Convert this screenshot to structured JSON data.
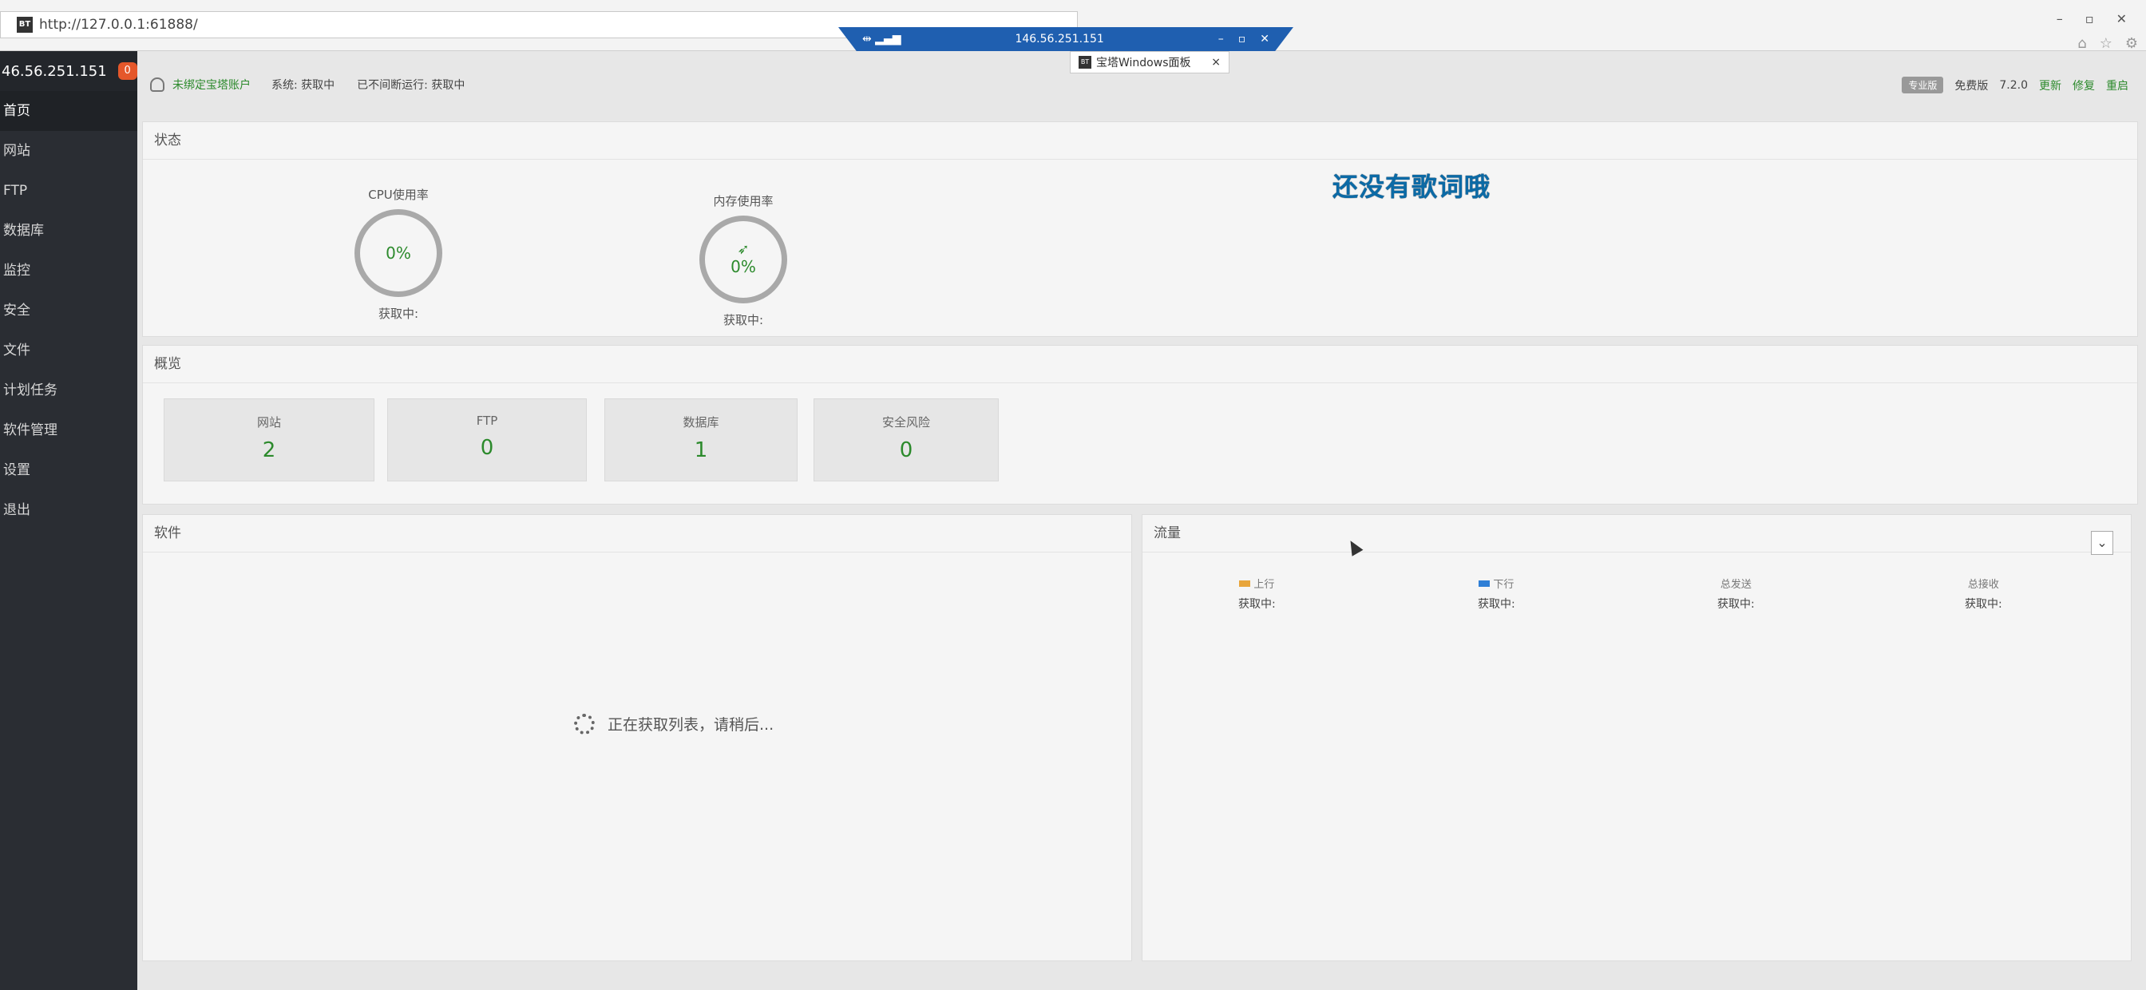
{
  "browser": {
    "url": "http://127.0.0.1:61888/",
    "favicon_text": "BT",
    "tab_title": "宝塔Windows面板",
    "tab_close": "×",
    "addr_search": "⌕",
    "addr_refresh": "⟳",
    "window_controls": [
      "–",
      "▫",
      "✕"
    ]
  },
  "remote_bar": {
    "title": "146.56.251.151",
    "controls": [
      "–",
      "▫",
      "✕"
    ]
  },
  "sidebar": {
    "host": "46.56.251.151",
    "badge": "0",
    "items": [
      "首页",
      "网站",
      "FTP",
      "数据库",
      "监控",
      "安全",
      "文件",
      "计划任务",
      "软件管理",
      "设置",
      "退出"
    ],
    "active_index": 0
  },
  "topbar": {
    "bind_account": "未绑定宝塔账户",
    "system": "系统:",
    "system_value": "获取中",
    "uptime": "已不间断运行: 获取中",
    "pro_label": "专业版",
    "edition": "免费版",
    "version": "7.2.0",
    "update": "更新",
    "repair": "修复",
    "restart": "重启"
  },
  "status": {
    "title": "状态",
    "cpu_label": "CPU使用率",
    "cpu_value": "0%",
    "cpu_sub": "获取中:",
    "mem_label": "内存使用率",
    "mem_value": "0%",
    "mem_sub": "获取中:",
    "banner": "还没有歌词哦"
  },
  "overview": {
    "title": "概览",
    "cards": [
      {
        "label": "网站",
        "value": "2"
      },
      {
        "label": "FTP",
        "value": "0"
      },
      {
        "label": "数据库",
        "value": "1"
      },
      {
        "label": "安全风险",
        "value": "0"
      }
    ]
  },
  "software": {
    "title": "软件",
    "loading": "正在获取列表，请稍后..."
  },
  "traffic": {
    "title": "流量",
    "dropdown": "⌄",
    "stats": [
      {
        "label": "上行",
        "value": "获取中:",
        "color": "#e8a53a"
      },
      {
        "label": "下行",
        "value": "获取中:",
        "color": "#2f7fd6"
      },
      {
        "label": "总发送",
        "value": "获取中:"
      },
      {
        "label": "总接收",
        "value": "获取中:"
      }
    ]
  }
}
